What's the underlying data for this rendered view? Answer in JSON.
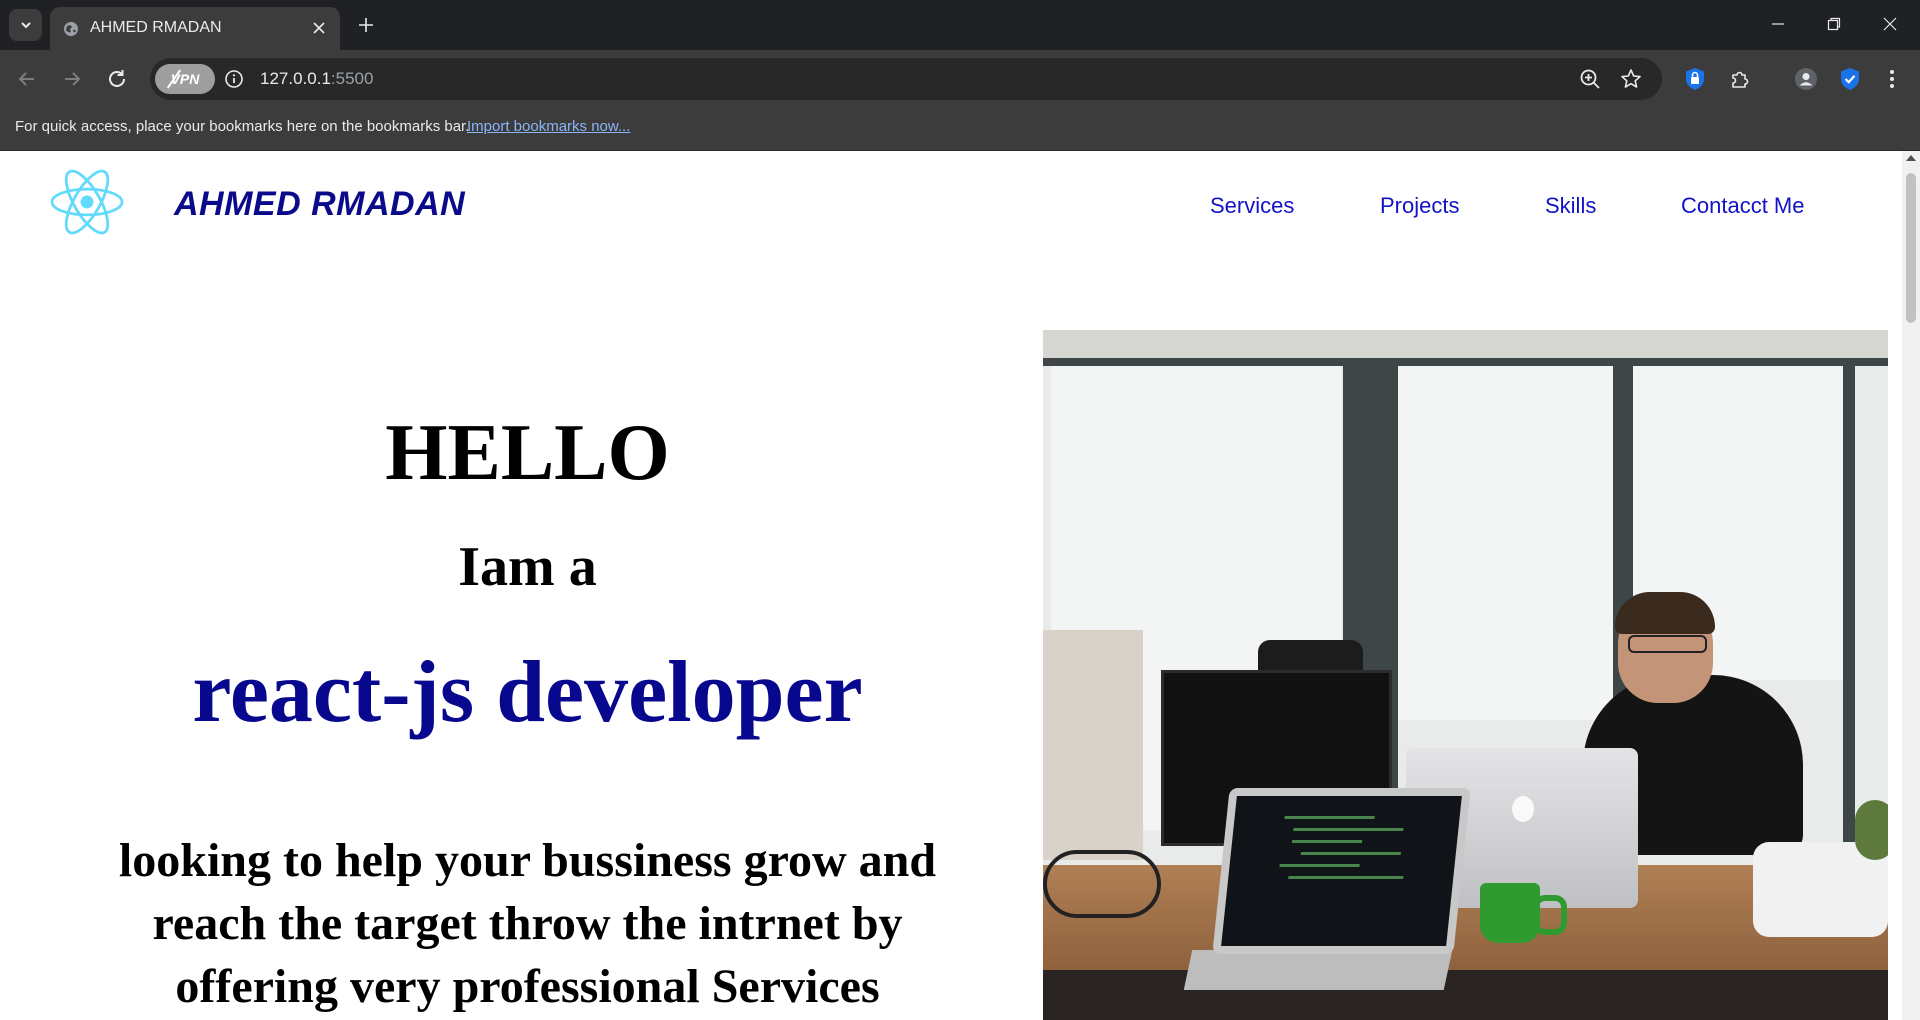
{
  "browser": {
    "tab_title": "AHMED RMADAN",
    "vpn_label": "VPN",
    "url_host": "127.0.0.1",
    "url_port": ":5500",
    "bookmarks_bar_text": "For quick access, place your bookmarks here on the bookmarks bar.",
    "bookmarks_import_link": "Import bookmarks now..."
  },
  "site": {
    "brand": "AHMED RMADAN",
    "nav": [
      "Services",
      "Projects",
      "Skills",
      "Contacct Me"
    ],
    "hero": {
      "greeting": "HELLO",
      "intro": "Iam a",
      "role": "react-js developer",
      "pitch_lines": [
        "looking to help your bussiness grow and",
        "reach the target throw the intrnet by",
        "offering very professional Services"
      ]
    }
  },
  "colors": {
    "brand_blue": "#0a0a8a",
    "nav_blue": "#1212c8",
    "role_blue": "#08088e",
    "react_cyan": "#61dafb"
  }
}
